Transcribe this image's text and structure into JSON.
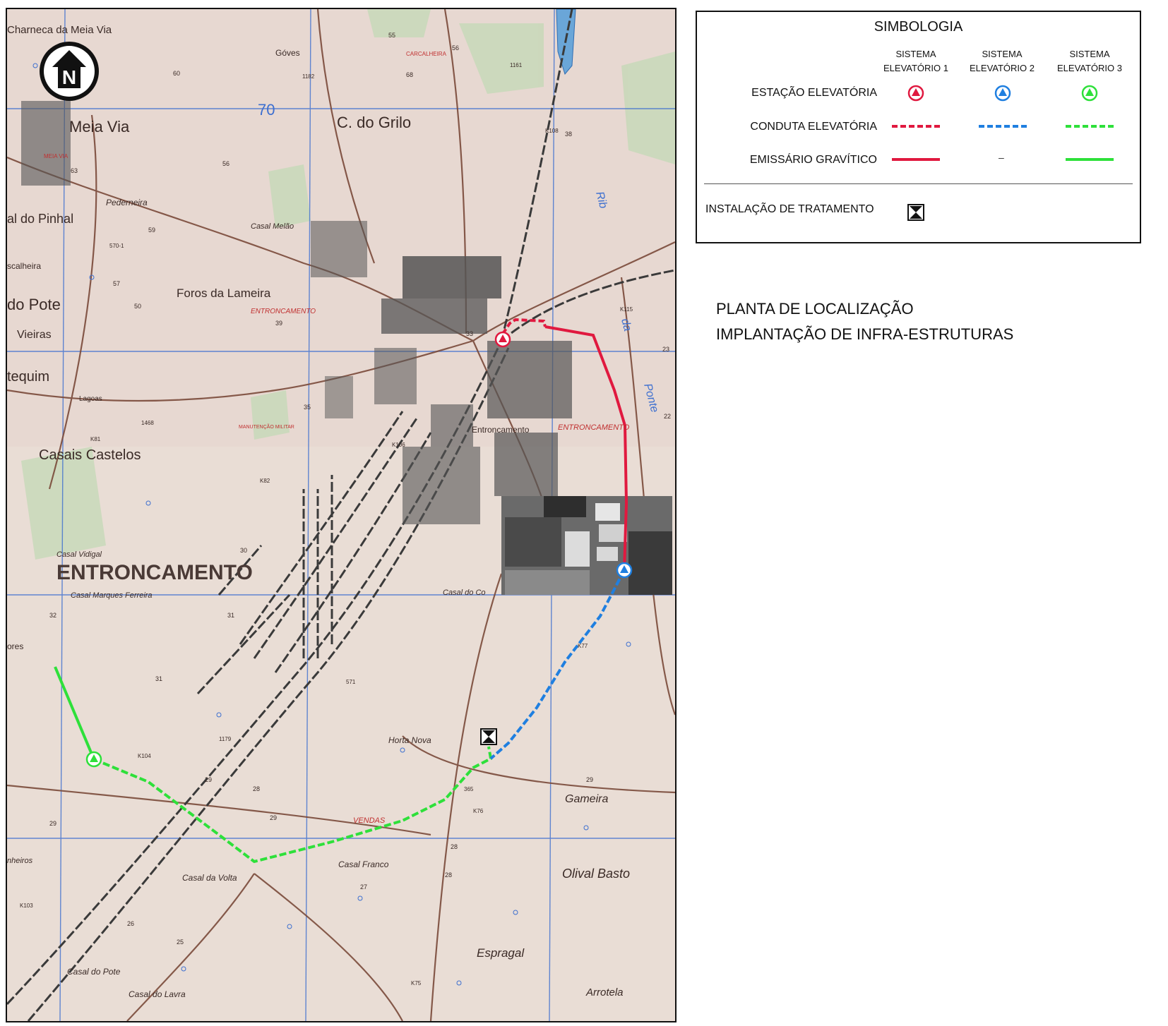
{
  "legend": {
    "title": "SIMBOLOGIA",
    "columns": [
      {
        "line1": "SISTEMA",
        "line2": "ELEVATÓRIO 1",
        "color": "#e0193f"
      },
      {
        "line1": "SISTEMA",
        "line2": "ELEVATÓRIO 2",
        "color": "#1f7fe0"
      },
      {
        "line1": "SISTEMA",
        "line2": "ELEVATÓRIO 3",
        "color": "#2ee03a"
      }
    ],
    "rows": {
      "station": "ESTAÇÃO ELEVATÓRIA",
      "pipe": "CONDUTA ELEVATÓRIA",
      "gravity": "EMISSÁRIO GRAVÍTICO",
      "treatment": "INSTALAÇÃO DE TRATAMENTO",
      "gravity_missing": "–"
    }
  },
  "titles": {
    "line1": "PLANTA DE LOCALIZAÇÃO",
    "line2": "IMPLANTAÇÃO DE INFRA-ESTRUTURAS"
  },
  "map": {
    "north_label": "N",
    "grid_label": "70",
    "labels": {
      "charneca": "Charneca da Meia Via",
      "meia_via": "Meia Via",
      "meia_via_small": "MEIA VIA",
      "goves": "Góves",
      "carcalheira": "CARCALHEIRA",
      "c_do_grilo": "C. do Grilo",
      "pederneira": "Pederneira",
      "pinhal": "al do Pinhal",
      "casal_melao": "Casal Melão",
      "calheira": "scalheira",
      "do_pote": "do Pote",
      "foros": "Foros da Lameira",
      "entroncamento_red": "ENTRONCAMENTO",
      "vieiras": "Vieiras",
      "tequim": "tequim",
      "lagoas": "Lagoas",
      "casais_castelos": "Casais Castelos",
      "manutencao": "MANUTENÇÃO MILITAR",
      "entroncamento_small": "Entroncamento",
      "entroncamento_red2": "ENTRONCAMENTO",
      "entroncamento_big": "ENTRONCAMENTO",
      "casal_vidigal": "Casal Vidigal",
      "casal_marques": "Casal Marques Ferreira",
      "casal_do_co": "Casal do Co",
      "res": "ores",
      "horta_nova": "Horta Nova",
      "gameira": "Gameira",
      "vendas": "VENDAS",
      "casal_franco": "Casal Franco",
      "olival_basto": "Olival Basto",
      "casal_da_volta": "Casal da Volta",
      "pinheiros": "nheiros",
      "espragal": "Espragal",
      "casal_do_pote": "Casal do Pote",
      "casal_do_lavra": "Casal do Lavra",
      "arrotela": "Arrotela",
      "ribeira": "Rib",
      "ponte": "Ponte",
      "da": "da"
    },
    "road_codes": [
      "1182",
      "1161",
      "570-1",
      "1468",
      "K81",
      "K82",
      "K106",
      "K108",
      "K115",
      "1179",
      "571",
      "365",
      "K104",
      "K103",
      "K76",
      "K77",
      "K75"
    ],
    "spot_heights": [
      "55",
      "56",
      "60",
      "68",
      "63",
      "56",
      "59",
      "57",
      "50",
      "39",
      "35",
      "30",
      "31",
      "32",
      "31",
      "29",
      "28",
      "29",
      "27",
      "26",
      "25",
      "28",
      "28",
      "29",
      "33",
      "38",
      "23",
      "22",
      "29"
    ],
    "colors": {
      "paper": "#e9ddd5",
      "grid": "#3d6fd0",
      "road": "#7a4a3a",
      "rail": "#3a3a3a",
      "building": "#555555",
      "system1": "#e0193f",
      "system2": "#1f7fe0",
      "system3": "#2ee03a"
    }
  }
}
